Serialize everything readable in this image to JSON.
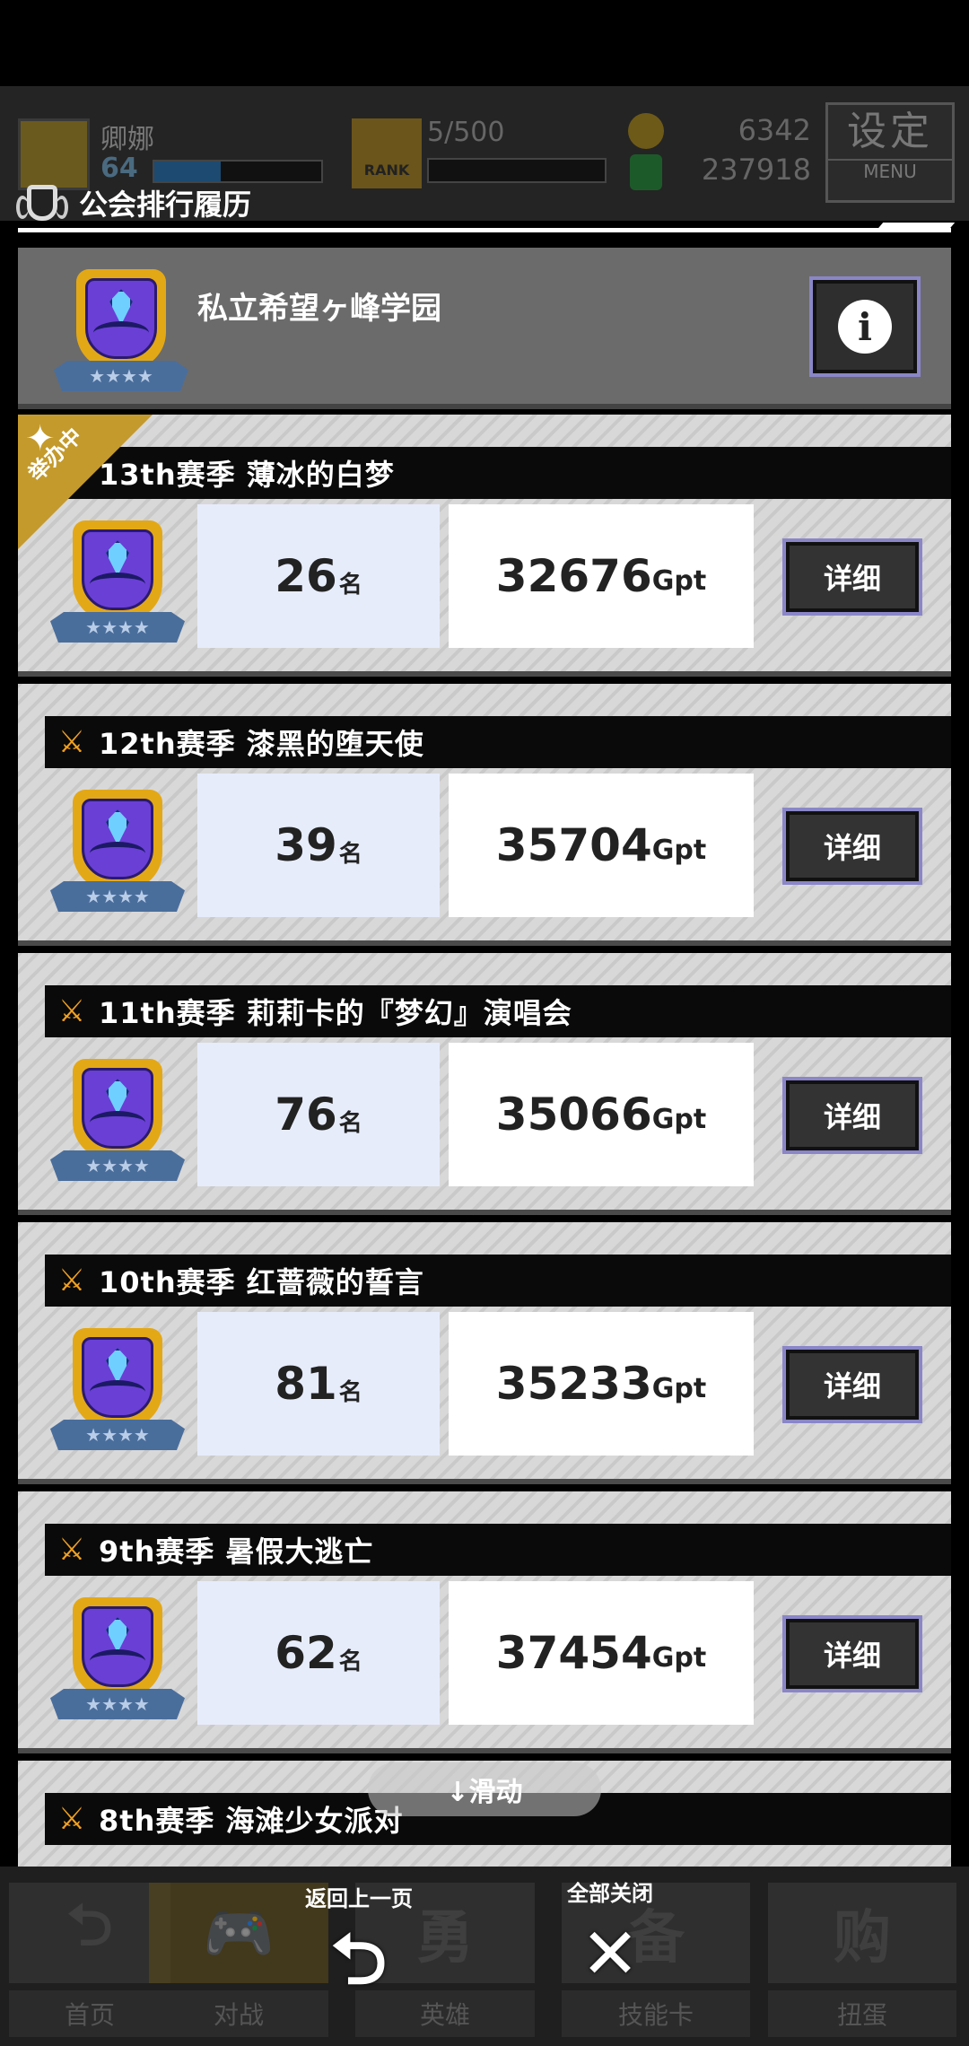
{
  "header_bg": {
    "player_name": "卿娜",
    "level": "64",
    "rank_badge": "RANK",
    "stamina": "5/500",
    "coins": "6342",
    "gems": "237918",
    "menu_big": "设定",
    "menu_small": "MENU"
  },
  "panel": {
    "title": "公会排行履历"
  },
  "guild": {
    "name": "私立希望ヶ峰学园",
    "info_icon": "i",
    "stars": "★★★★"
  },
  "seasons": [
    {
      "label": "13th赛季 薄冰的白梦",
      "rank": "26",
      "rank_suffix": "名",
      "points": "32676",
      "points_suffix": "Gpt",
      "detail": "详细",
      "holding": "举办中"
    },
    {
      "label": "12th赛季 漆黑的堕天使",
      "rank": "39",
      "rank_suffix": "名",
      "points": "35704",
      "points_suffix": "Gpt",
      "detail": "详细"
    },
    {
      "label": "11th赛季 莉莉卡的『梦幻』演唱会",
      "rank": "76",
      "rank_suffix": "名",
      "points": "35066",
      "points_suffix": "Gpt",
      "detail": "详细"
    },
    {
      "label": "10th赛季 红蔷薇的誓言",
      "rank": "81",
      "rank_suffix": "名",
      "points": "35233",
      "points_suffix": "Gpt",
      "detail": "详细"
    },
    {
      "label": "9th赛季 暑假大逃亡",
      "rank": "62",
      "rank_suffix": "名",
      "points": "37454",
      "points_suffix": "Gpt",
      "detail": "详细"
    },
    {
      "label": "8th赛季 海滩少女派对"
    }
  ],
  "scroll_hint": "↓滑动",
  "actions": {
    "back_label": "返回上一页",
    "back_icon": "⮌",
    "close_label": "全部关闭",
    "close_icon": "✕"
  },
  "bottom_nav": [
    {
      "label": "首页",
      "art": "⮌"
    },
    {
      "label": "对战",
      "art": "🎮"
    },
    {
      "label": "英雄",
      "art": "勇"
    },
    {
      "label": "技能卡",
      "art": "备"
    },
    {
      "label": "扭蛋",
      "art": "购"
    }
  ],
  "colors": {
    "accent_gold": "#e3a816",
    "emblem_purple": "#6a3fd6",
    "button_border": "#8a86c8",
    "rank_cell_bg": "#e7ecfb"
  }
}
